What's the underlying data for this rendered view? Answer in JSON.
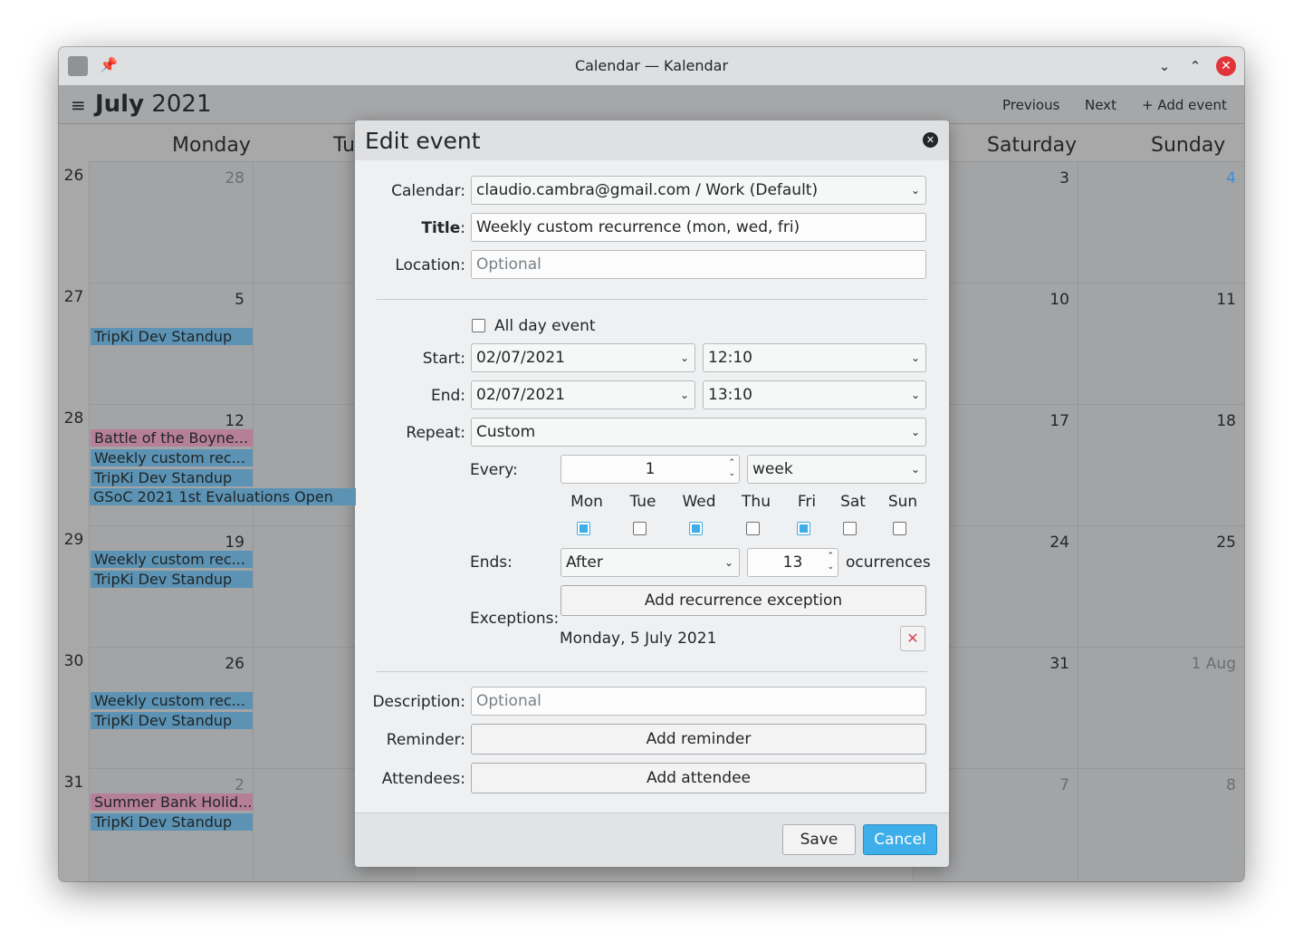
{
  "window": {
    "title": "Calendar — Kalendar"
  },
  "toolbar": {
    "month": "July",
    "year": "2021",
    "previous": "Previous",
    "next": "Next",
    "add_event": "Add event"
  },
  "weekdays": [
    "Monday",
    "Tu",
    "Saturday",
    "Sunday"
  ],
  "weeks": [
    {
      "num": "26",
      "monday": "28",
      "saturday": "3",
      "sunday": "4"
    },
    {
      "num": "27",
      "monday": "5",
      "saturday": "10",
      "sunday": "11"
    },
    {
      "num": "28",
      "monday": "12",
      "saturday": "17",
      "sunday": "18"
    },
    {
      "num": "29",
      "monday": "19",
      "saturday": "24",
      "sunday": "25"
    },
    {
      "num": "30",
      "monday": "26",
      "saturday": "31",
      "sunday": "1 Aug"
    },
    {
      "num": "31",
      "monday": "2",
      "saturday": "7",
      "sunday": "8"
    }
  ],
  "events": {
    "w27": [
      "TripKi Dev Standup"
    ],
    "w28": [
      "Battle of the Boyne...",
      "Weekly custom rec...",
      "TripKi Dev Standup",
      "GSoC 2021 1st Evaluations Open"
    ],
    "w29": [
      "Weekly custom rec...",
      "TripKi Dev Standup"
    ],
    "w30": [
      "Weekly custom rec...",
      "TripKi Dev Standup"
    ],
    "w31": [
      "Summer Bank Holid...",
      "TripKi Dev Standup"
    ]
  },
  "colors": {
    "event_blue": "#5c93b4",
    "event_pink": "#b67f98",
    "accent": "#3daee9"
  },
  "dialog": {
    "title": "Edit event",
    "calendar_label": "Calendar:",
    "calendar_value": "claudio.cambra@gmail.com / Work (Default)",
    "title_label": "Title",
    "title_colon": ":",
    "title_value": "Weekly custom recurrence (mon, wed, fri)",
    "location_label": "Location:",
    "location_placeholder": "Optional",
    "all_day": "All day event",
    "start_label": "Start:",
    "start_date": "02/07/2021",
    "start_time": "12:10",
    "end_label": "End:",
    "end_date": "02/07/2021",
    "end_time": "13:10",
    "repeat_label": "Repeat:",
    "repeat_value": "Custom",
    "every_label": "Every:",
    "every_value": "1",
    "every_unit": "week",
    "days": [
      "Mon",
      "Tue",
      "Wed",
      "Thu",
      "Fri",
      "Sat",
      "Sun"
    ],
    "ends_label": "Ends:",
    "ends_value": "After",
    "occurrences_value": "13",
    "occurrences_label": "ocurrences",
    "exceptions_label": "Exceptions:",
    "add_exception": "Add recurrence exception",
    "exception_item": "Monday, 5 July 2021",
    "description_label": "Description:",
    "description_placeholder": "Optional",
    "reminder_label": "Reminder:",
    "add_reminder": "Add reminder",
    "attendees_label": "Attendees:",
    "add_attendee": "Add attendee",
    "save": "Save",
    "cancel": "Cancel"
  }
}
